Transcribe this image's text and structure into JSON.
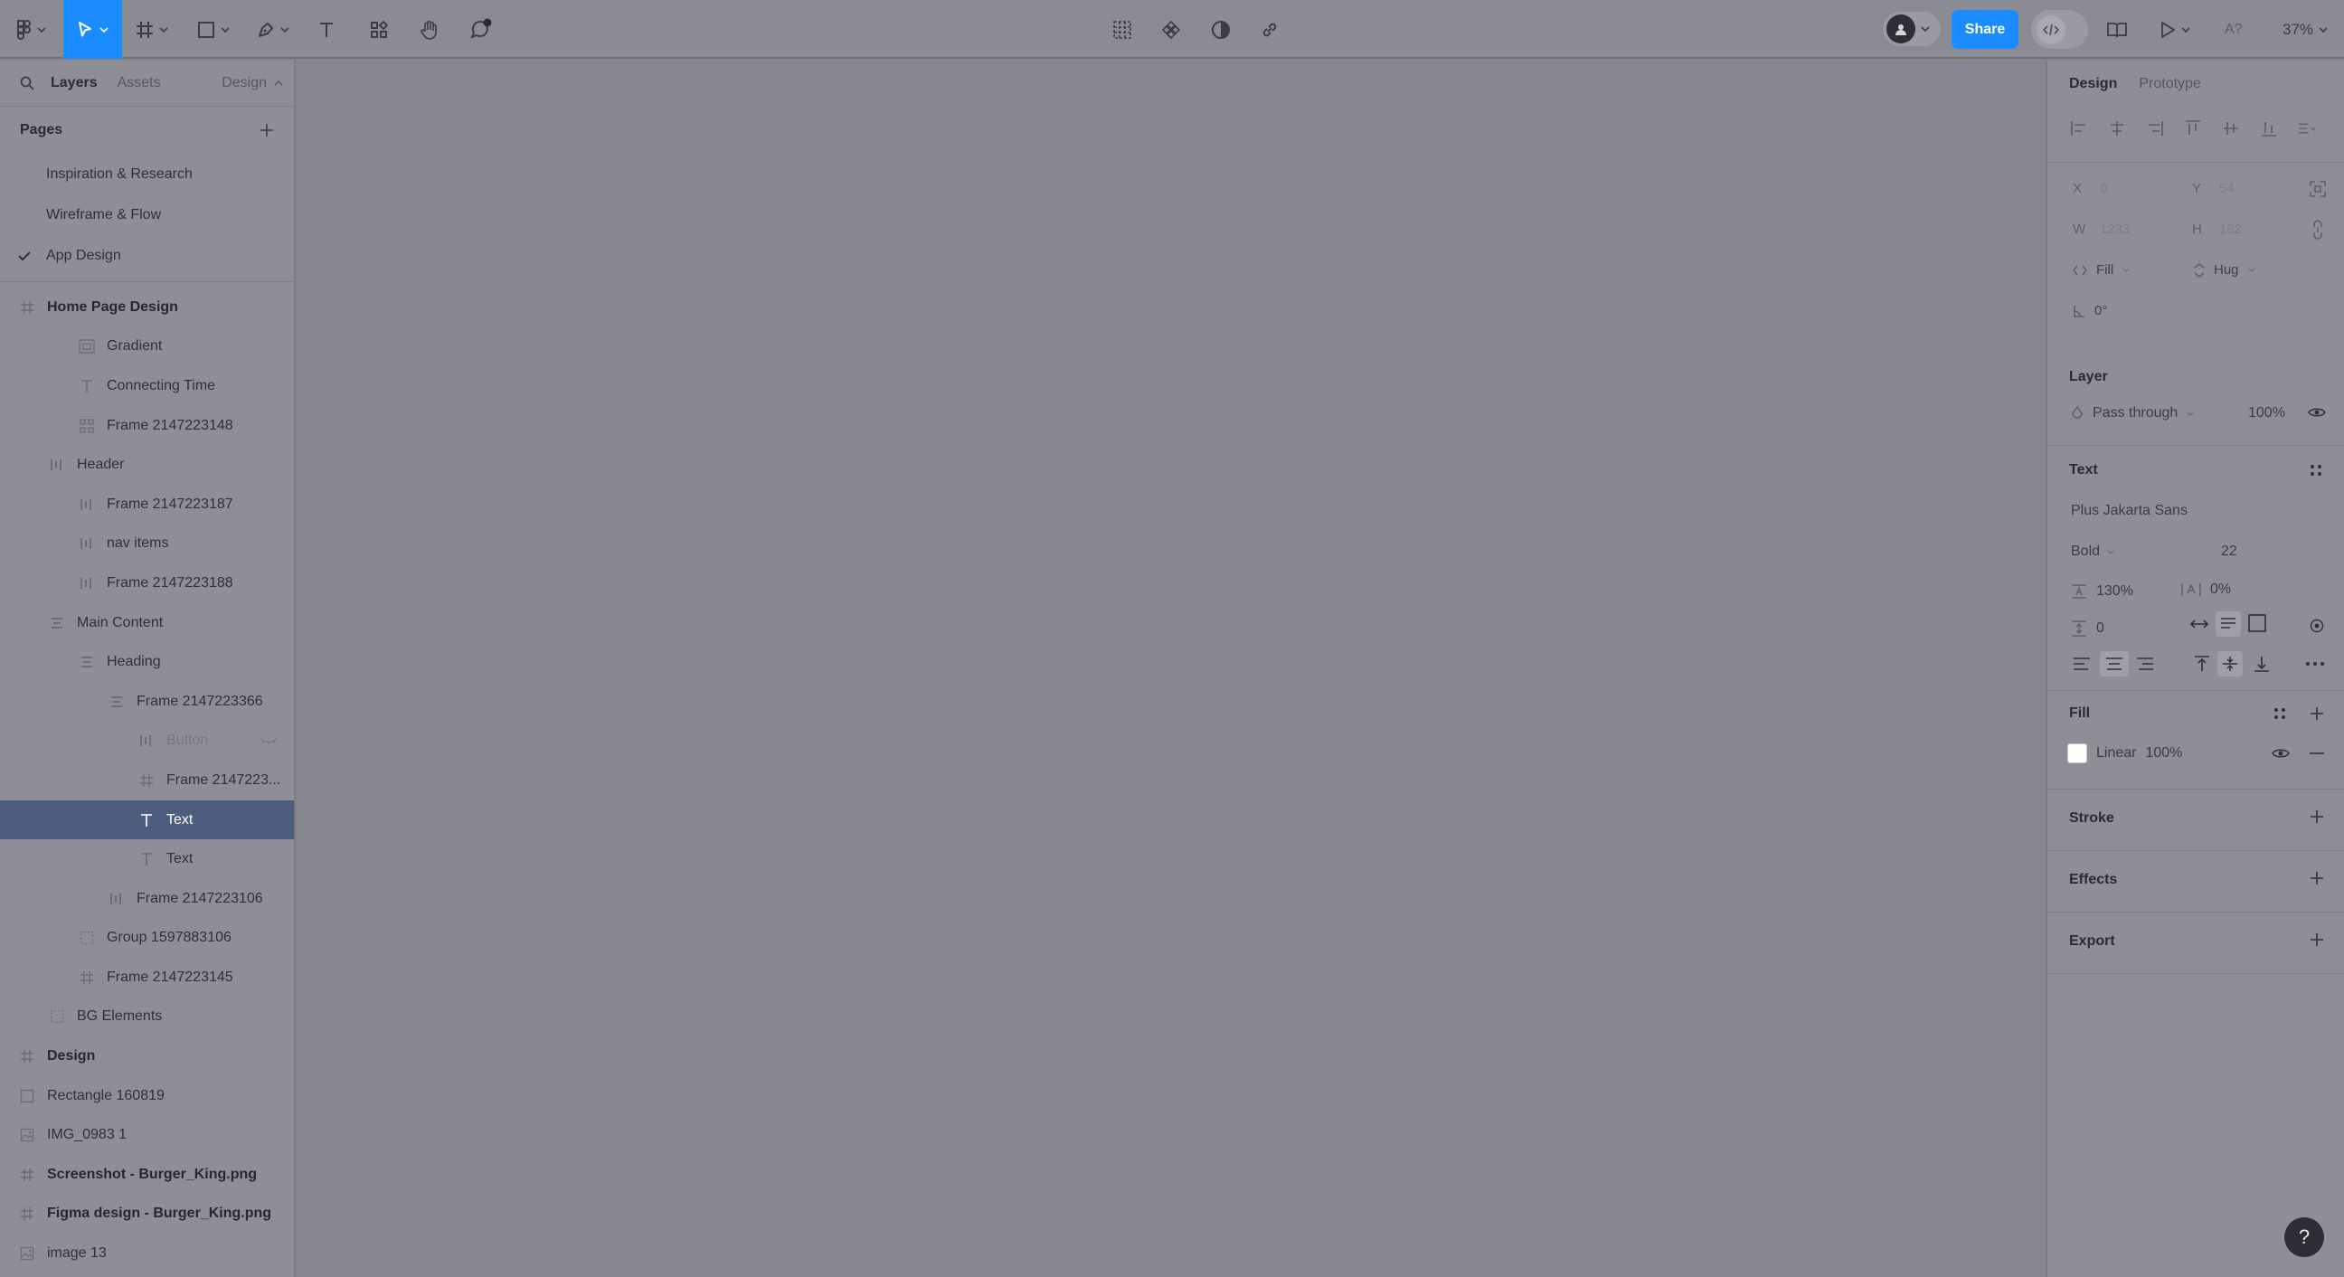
{
  "toolbar": {
    "share_label": "Share",
    "zoom": "37%",
    "a_question": "A?",
    "notification_count": "●"
  },
  "left_panel": {
    "tabs": [
      "Layers",
      "Assets"
    ],
    "design_switch": "Design",
    "pages_title": "Pages",
    "pages": [
      {
        "label": "Inspiration & Research",
        "current": false
      },
      {
        "label": "Wireframe & Flow",
        "current": false
      },
      {
        "label": "App Design",
        "current": true
      }
    ],
    "layers": [
      {
        "label": "Home Page Design",
        "icon": "frame-icon",
        "indent": 0,
        "bold": true
      },
      {
        "label": "Gradient",
        "icon": "gradient-frame-icon",
        "indent": 2
      },
      {
        "label": "Connecting Time",
        "icon": "text-icon",
        "indent": 2
      },
      {
        "label": "Frame 2147223148",
        "icon": "autolayout-grid-icon",
        "indent": 2
      },
      {
        "label": "Header",
        "icon": "autolayout-horizontal-icon",
        "indent": 1
      },
      {
        "label": "Frame 2147223187",
        "icon": "autolayout-horizontal-icon",
        "indent": 2
      },
      {
        "label": "nav items",
        "icon": "autolayout-horizontal-icon",
        "indent": 2
      },
      {
        "label": "Frame 2147223188",
        "icon": "autolayout-horizontal-icon",
        "indent": 2
      },
      {
        "label": "Main Content",
        "icon": "autolayout-vertical-icon",
        "indent": 1
      },
      {
        "label": "Heading",
        "icon": "autolayout-vertical-icon",
        "indent": 2
      },
      {
        "label": "Frame 2147223366",
        "icon": "autolayout-vertical-icon",
        "indent": 3
      },
      {
        "label": "Button",
        "icon": "autolayout-horizontal-icon",
        "indent": 4,
        "dim": true,
        "hidden": true
      },
      {
        "label": "Frame 2147223...",
        "icon": "frame-icon",
        "indent": 4
      },
      {
        "label": "Text",
        "icon": "text-icon",
        "indent": 4,
        "selected": true
      },
      {
        "label": "Text",
        "icon": "text-icon",
        "indent": 4
      },
      {
        "label": "Frame 2147223106",
        "icon": "autolayout-horizontal-icon",
        "indent": 3
      },
      {
        "label": "Group 1597883106",
        "icon": "group-icon",
        "indent": 2
      },
      {
        "label": "Frame 2147223145",
        "icon": "frame-icon",
        "indent": 2
      },
      {
        "label": "BG Elements",
        "icon": "group-icon",
        "indent": 1
      },
      {
        "label": "Design",
        "icon": "frame-icon",
        "indent": 0,
        "bold": true
      },
      {
        "label": "Rectangle 160819",
        "icon": "rectangle-icon",
        "indent": 0
      },
      {
        "label": "IMG_0983 1",
        "icon": "image-icon",
        "indent": 0
      },
      {
        "label": "Screenshot - Burger_King.png",
        "icon": "frame-icon",
        "indent": 0,
        "bold": true
      },
      {
        "label": "Figma design - Burger_King.png",
        "icon": "frame-icon",
        "indent": 0,
        "bold": true
      },
      {
        "label": "image 13",
        "icon": "image-icon",
        "indent": 0
      }
    ]
  },
  "right_panel": {
    "tabs": [
      "Design",
      "Prototype"
    ],
    "geometry": {
      "x_label": "X",
      "x_value": "0",
      "y_label": "Y",
      "y_value": "54",
      "w_label": "W",
      "w_value": "1233",
      "h_label": "H",
      "h_value": "182",
      "width_mode": "Fill",
      "height_mode": "Hug",
      "rotation": "0°"
    },
    "layer": {
      "title": "Layer",
      "blend": "Pass through",
      "opacity": "100%"
    },
    "text": {
      "title": "Text",
      "font": "Plus Jakarta Sans",
      "weight": "Bold",
      "size": "22",
      "line_height": "130%",
      "letter_spacing": "0%",
      "paragraph_spacing": "0"
    },
    "fill": {
      "title": "Fill",
      "type": "Linear",
      "opacity": "100%",
      "swatch_color": "#ffffff"
    },
    "stroke_title": "Stroke",
    "effects_title": "Effects",
    "export_title": "Export"
  },
  "help_label": "?"
}
